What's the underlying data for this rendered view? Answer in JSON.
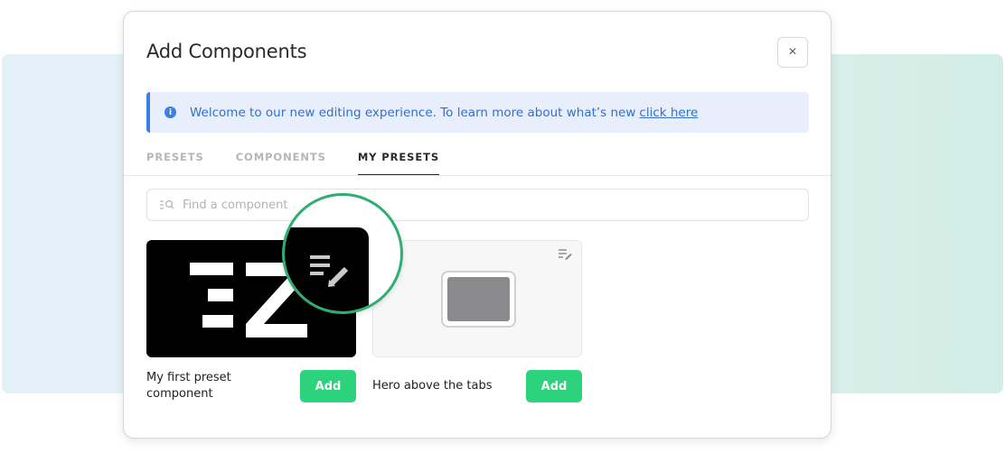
{
  "modal": {
    "title": "Add Components",
    "close_label": "×"
  },
  "banner": {
    "icon": "info-icon",
    "message": "Welcome to our new editing experience. To learn more about what’s new",
    "link": "click here"
  },
  "tabs": [
    {
      "label": "PRESETS",
      "active": false
    },
    {
      "label": "COMPONENTS",
      "active": false
    },
    {
      "label": "MY PRESETS",
      "active": true
    }
  ],
  "search": {
    "placeholder": "Find a component",
    "value": ""
  },
  "presets": [
    {
      "name": "My first preset component",
      "thumbnail": "logo-thumbnail",
      "add_label": "Add"
    },
    {
      "name": "Hero above the tabs",
      "thumbnail": "placeholder-thumbnail",
      "add_label": "Add"
    }
  ],
  "colors": {
    "accent_green": "#2dd37c",
    "banner_blue": "#3b7fe0",
    "highlight_ring": "#2fae74"
  }
}
